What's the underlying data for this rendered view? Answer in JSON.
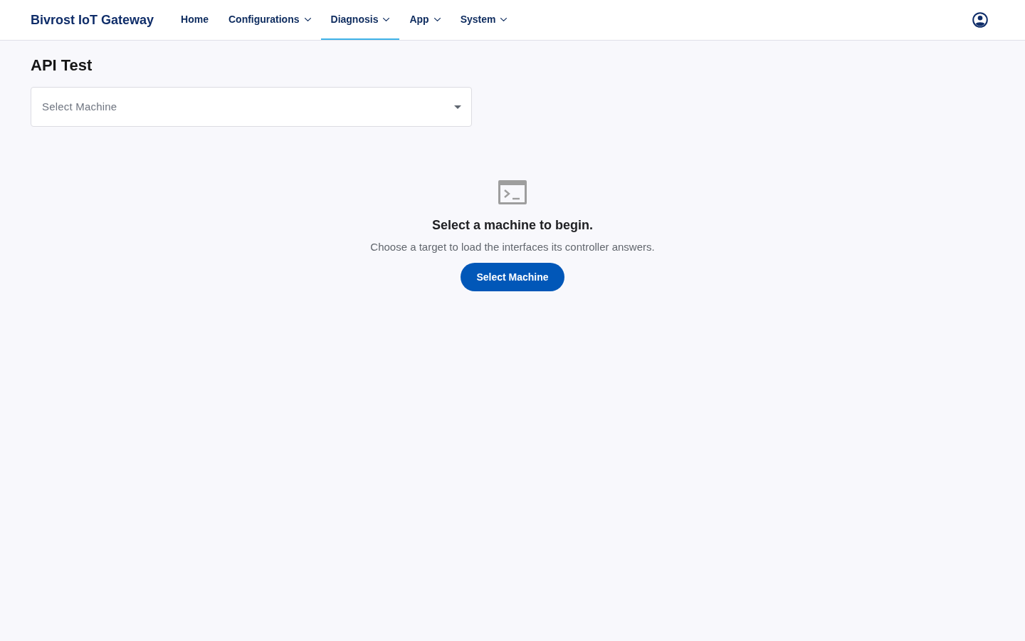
{
  "header": {
    "brand": "Bivrost IoT Gateway",
    "nav": [
      {
        "label": "Home",
        "has_menu": false,
        "selected": false
      },
      {
        "label": "Configurations",
        "has_menu": true,
        "selected": false
      },
      {
        "label": "Diagnosis",
        "has_menu": true,
        "selected": true
      },
      {
        "label": "App",
        "has_menu": true,
        "selected": false
      },
      {
        "label": "System",
        "has_menu": true,
        "selected": false
      }
    ]
  },
  "page": {
    "title": "API Test",
    "machine_select": {
      "placeholder": "Select Machine"
    },
    "empty_state": {
      "heading": "Select a machine to begin.",
      "description": "Choose a target to load the interfaces its controller answers.",
      "button": "Select Machine"
    }
  }
}
